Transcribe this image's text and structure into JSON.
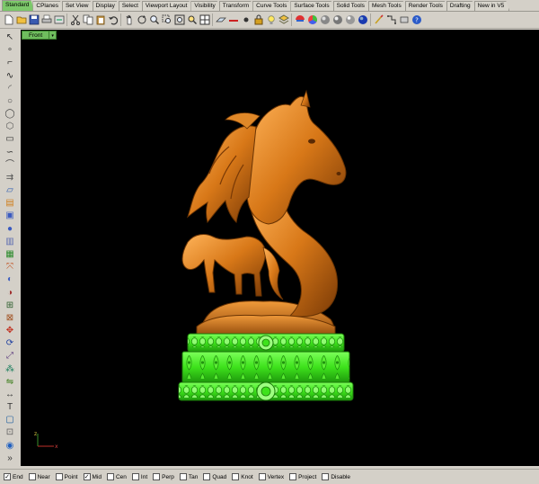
{
  "tabs": [
    "Standard",
    "CPlanes",
    "Set View",
    "Display",
    "Select",
    "Viewport Layout",
    "Visibility",
    "Transform",
    "Curve Tools",
    "Surface Tools",
    "Solid Tools",
    "Mesh Tools",
    "Render Tools",
    "Drafting",
    "New in V5"
  ],
  "viewport": {
    "label": "Front",
    "dropdown_glyph": "▾"
  },
  "axis": {
    "x": "x",
    "z": "z"
  },
  "osnaps": [
    {
      "label": "End",
      "checked": true
    },
    {
      "label": "Near",
      "checked": false
    },
    {
      "label": "Point",
      "checked": false
    },
    {
      "label": "Mid",
      "checked": true
    },
    {
      "label": "Cen",
      "checked": false
    },
    {
      "label": "Int",
      "checked": false
    },
    {
      "label": "Perp",
      "checked": false
    },
    {
      "label": "Tan",
      "checked": false
    },
    {
      "label": "Quad",
      "checked": false
    },
    {
      "label": "Knot",
      "checked": false
    },
    {
      "label": "Vertex",
      "checked": false
    },
    {
      "label": "Project",
      "checked": false
    },
    {
      "label": "Disable",
      "checked": false
    }
  ],
  "toolbar_icons": [
    "new-file-icon",
    "open-file-icon",
    "save-icon",
    "print-icon",
    "import-icon",
    "cut-icon",
    "copy-icon",
    "paste-icon",
    "undo-icon",
    "pan-icon",
    "rotate-view-icon",
    "zoom-icon",
    "zoom-window-icon",
    "zoom-extents-icon",
    "zoom-selected-icon",
    "viewport-grid-icon",
    "cplane-icon",
    "hide-icon",
    "show-icon",
    "lock-icon",
    "lightbulb-icon",
    "layer-icon",
    "properties-icon",
    "color-wheel-icon",
    "shaded-sphere-icon",
    "rendered-sphere-icon",
    "material-sphere-icon",
    "blue-sphere-icon",
    "gumball-icon",
    "snap-grid-icon",
    "options-icon",
    "help-icon"
  ],
  "left_icons": [
    "select-arrow-icon",
    "point-icon",
    "polyline-icon",
    "curve-icon",
    "arc-icon",
    "circle-icon",
    "ellipse-icon",
    "polygon-icon",
    "rectangle-icon",
    "free-curve-icon",
    "fillet-icon",
    "offset-icon",
    "surface-icon",
    "extrude-icon",
    "box-icon",
    "sphere-icon",
    "cylinder-icon",
    "mesh-icon",
    "transform-icon",
    "boolean-icon",
    "split-icon",
    "join-icon",
    "explode-icon",
    "move-icon",
    "rotate-icon",
    "scale-icon",
    "array-icon",
    "mirror-icon",
    "dimension-icon",
    "text-icon",
    "block-icon",
    "group-icon",
    "render-icon",
    "more-icon"
  ],
  "colors": {
    "model_gold": "#d87818",
    "pedestal_green": "#44ee22",
    "viewport_bg": "#000000",
    "tab_active": "#7cc86a"
  }
}
